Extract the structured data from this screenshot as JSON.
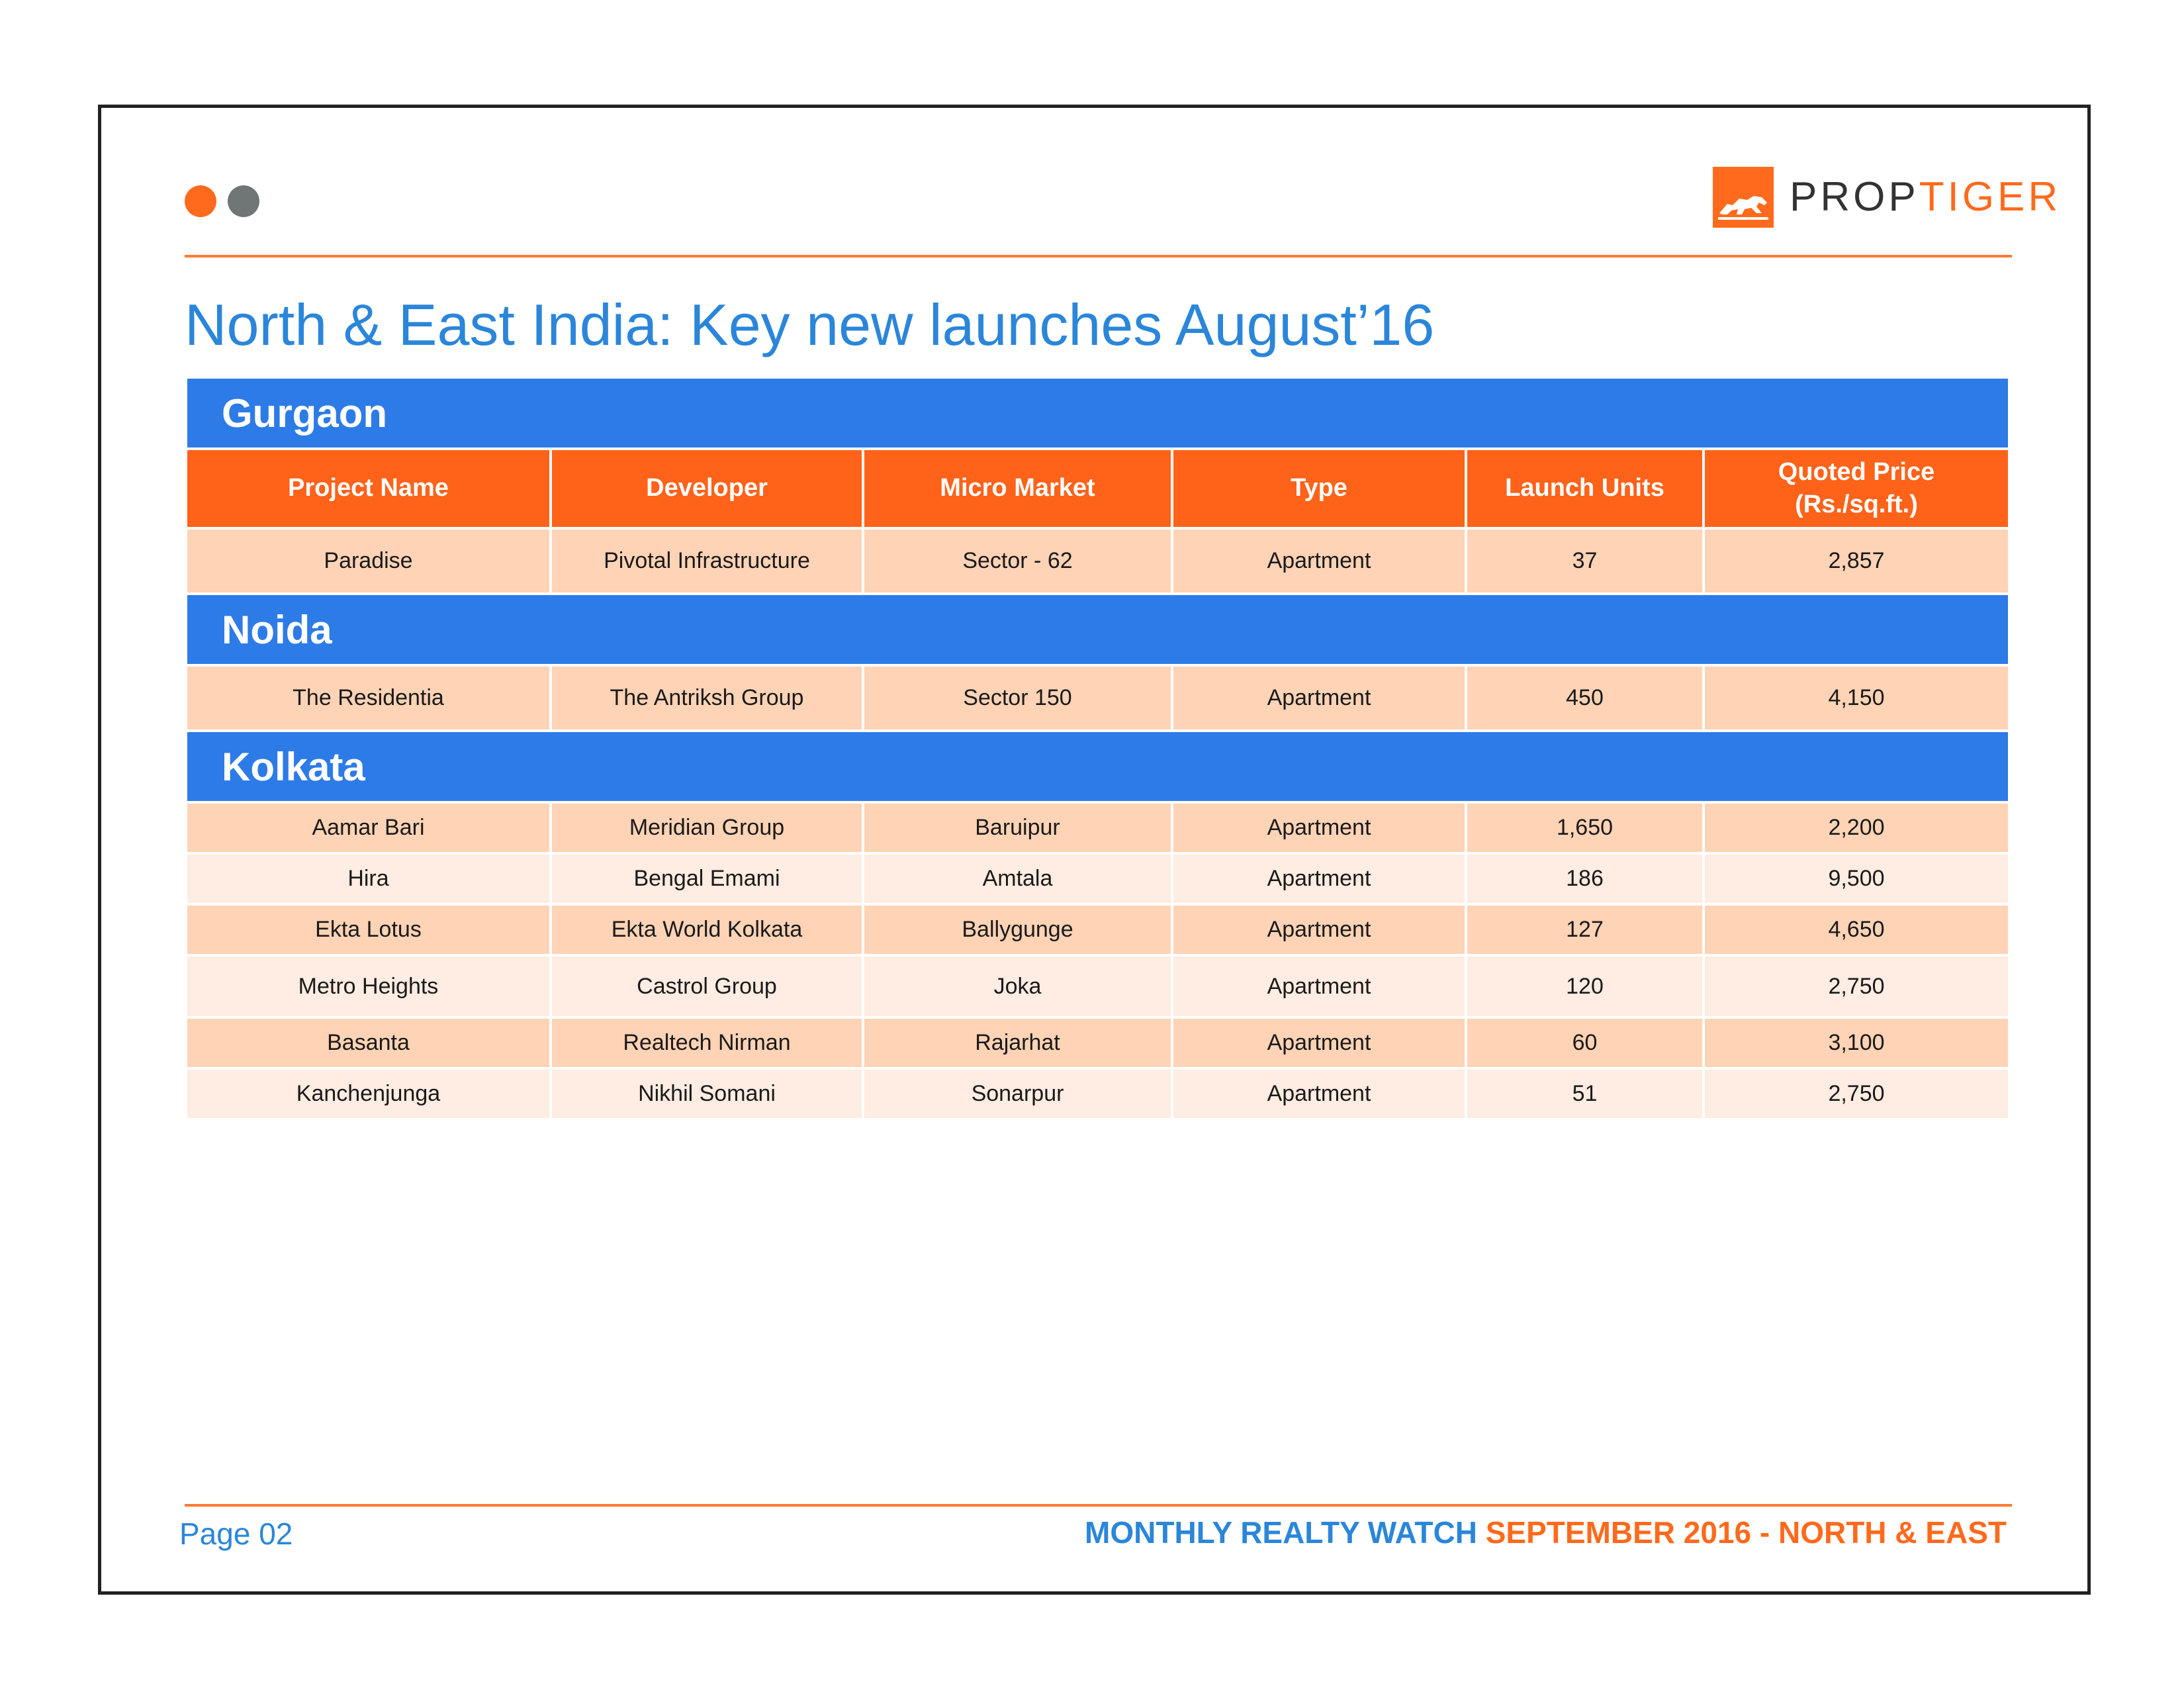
{
  "header": {
    "logo": {
      "icon": "tiger-icon",
      "prefix": "PROP",
      "suffix": "TIGER"
    }
  },
  "title": "North & East India: Key new launches August’16",
  "columns": [
    "Project Name",
    "Developer",
    "Micro Market",
    "Type",
    "Launch Units",
    "Quoted Price\n(Rs./sq.ft.)"
  ],
  "sections": [
    {
      "city": "Gurgaon",
      "rows": [
        [
          "Paradise",
          "Pivotal Infrastructure",
          "Sector - 62",
          "Apartment",
          "37",
          "2,857"
        ]
      ]
    },
    {
      "city": "Noida",
      "rows": [
        [
          "The Residentia",
          "The Antriksh Group",
          "Sector 150",
          "Apartment",
          "450",
          "4,150"
        ]
      ]
    },
    {
      "city": "Kolkata",
      "rows": [
        [
          "Aamar Bari",
          "Meridian Group",
          "Baruipur",
          "Apartment",
          "1,650",
          "2,200"
        ],
        [
          "Hira",
          "Bengal Emami",
          "Amtala",
          "Apartment",
          "186",
          "9,500"
        ],
        [
          "Ekta Lotus",
          "Ekta World Kolkata",
          "Ballygunge",
          "Apartment",
          "127",
          "4,650"
        ],
        [
          "Metro Heights",
          "Castrol Group",
          "Joka",
          "Apartment",
          "120",
          "2,750"
        ],
        [
          "Basanta",
          "Realtech Nirman",
          "Rajarhat",
          "Apartment",
          "60",
          "3,100"
        ],
        [
          "Kanchenjunga",
          "Nikhil Somani",
          "Sonarpur",
          "Apartment",
          "51",
          "2,750"
        ]
      ]
    }
  ],
  "footer": {
    "page": "Page 02",
    "publication": "MONTHLY REALTY WATCH",
    "edition": "SEPTEMBER 2016 - NORTH & EAST"
  },
  "colors": {
    "accent_orange": "#ff6219",
    "accent_blue": "#2d7be7",
    "row_dark": "#ffd3b5",
    "row_light": "#ffece2"
  }
}
